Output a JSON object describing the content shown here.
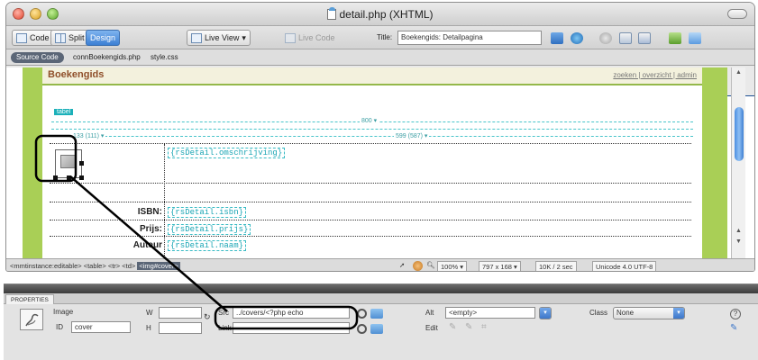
{
  "window": {
    "title": "detail.php (XHTML)"
  },
  "toolbar": {
    "code_label": "Code",
    "split_label": "Split",
    "design_label": "Design",
    "live_view_label": "Live View",
    "live_code_label": "Live Code",
    "title_label": "Title:",
    "title_value": "Boekengids: Detailpagina"
  },
  "filebar": {
    "source_label": "Source Code",
    "related_files": [
      "connBoekengids.php",
      "style.css"
    ]
  },
  "design": {
    "header_title": "Boekengids",
    "header_links": "zoeken | overzicht | admin",
    "div_tag": "tabel",
    "col_widths": [
      "133 (111) ▾",
      "599 (587) ▾"
    ],
    "table_width": "800 ▾",
    "rows": [
      {
        "label": "",
        "binding": "{rsDetail.omschrijving}"
      },
      {
        "label": "ISBN:",
        "binding": "{rsDetail.isbn}"
      },
      {
        "label": "Prijs:",
        "binding": "{rsDetail.prijs}"
      },
      {
        "label": "Auteur",
        "binding": "{rsDetail.naam}"
      }
    ]
  },
  "statusbar": {
    "tag_path": "<mmtinstance:editable> <table> <tr> <td>",
    "selected_tag": "<img#cover>",
    "zoom": "100%",
    "dimensions": "797 x 168",
    "filesize": "10K / 2 sec",
    "encoding": "Unicode 4.0 UTF-8"
  },
  "properties": {
    "tab_label": "PROPERTIES",
    "type_label": "Image",
    "id_label": "ID",
    "id_value": "cover",
    "w_label": "W",
    "h_label": "H",
    "src_label": "Src",
    "src_value": "../covers/<?php echo",
    "link_label": "Link",
    "alt_label": "Alt",
    "alt_value": "<empty>",
    "edit_label": "Edit",
    "class_label": "Class",
    "class_value": "None"
  },
  "colors": {
    "accent_blue": "#3c7fd3",
    "template_green": "#a9cf56",
    "binding_cyan": "#1aa5b4",
    "callout": "#000000"
  }
}
